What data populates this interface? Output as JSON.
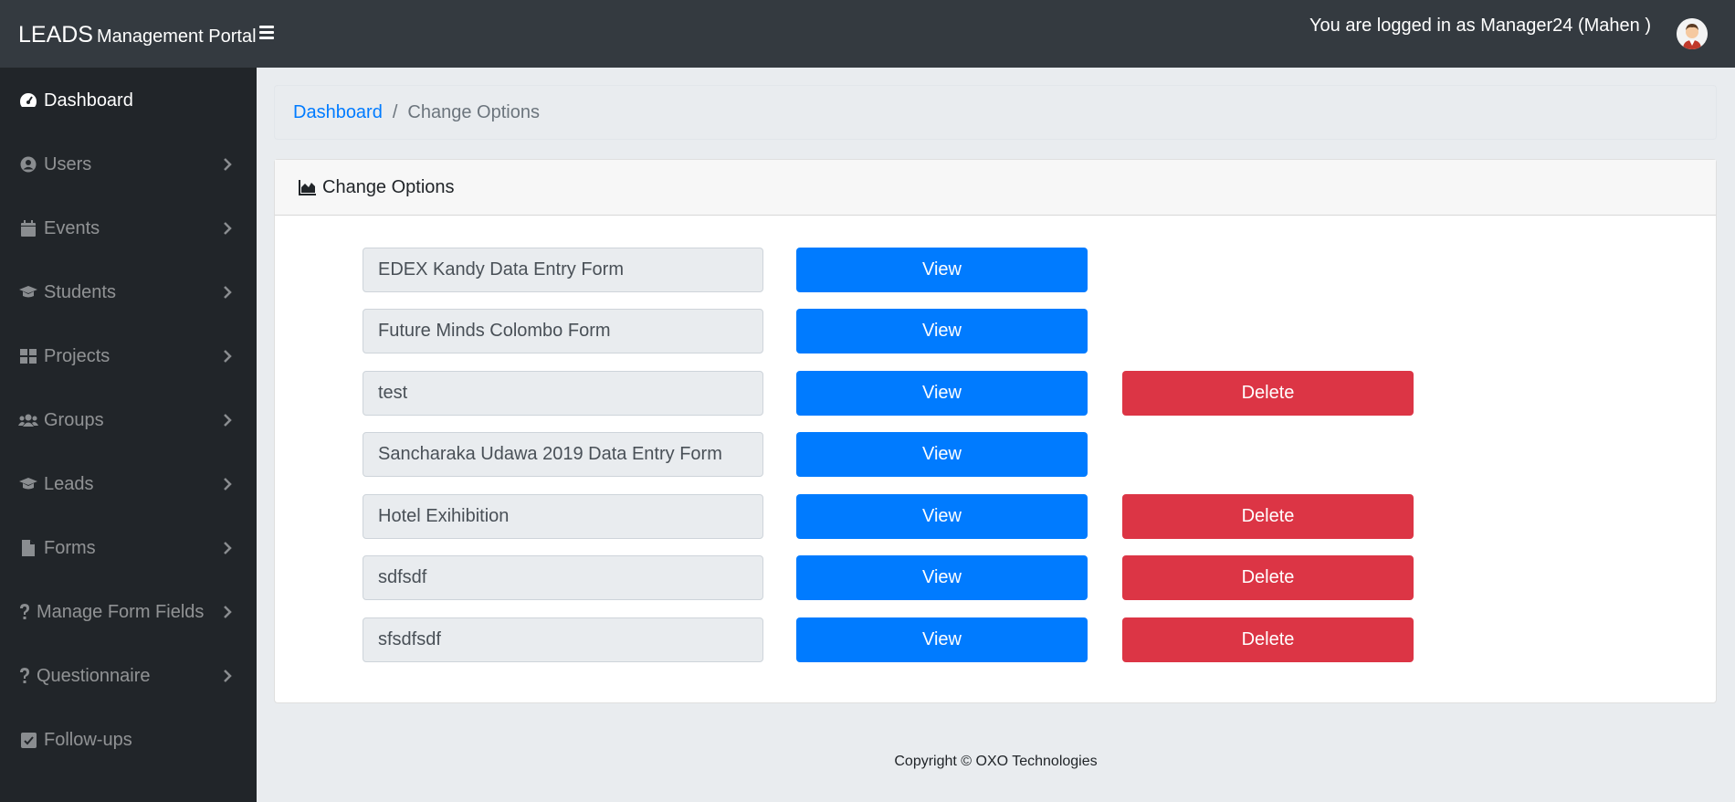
{
  "header": {
    "brand": "LEADS",
    "brand_sub": "Management Portal",
    "logged_in_text": "You are logged in as Manager24 (Mahen )"
  },
  "sidebar": {
    "items": [
      {
        "label": "Dashboard",
        "icon": "tachometer-icon"
      },
      {
        "label": "Users",
        "icon": "user-circle-icon"
      },
      {
        "label": "Events",
        "icon": "calendar-icon"
      },
      {
        "label": "Students",
        "icon": "graduation-cap-icon"
      },
      {
        "label": "Projects",
        "icon": "grid-icon"
      },
      {
        "label": "Groups",
        "icon": "users-icon"
      },
      {
        "label": "Leads",
        "icon": "graduation-cap-icon"
      },
      {
        "label": "Forms",
        "icon": "file-icon"
      },
      {
        "label": "Manage Form Fields",
        "icon": "question-icon"
      },
      {
        "label": "Questionnaire",
        "icon": "question-icon"
      },
      {
        "label": "Follow-ups",
        "icon": "check-square-icon"
      }
    ]
  },
  "breadcrumb": {
    "home": "Dashboard",
    "current": "Change Options"
  },
  "card": {
    "title": "Change Options",
    "view_label": "View",
    "delete_label": "Delete",
    "rows": [
      {
        "name": "EDEX Kandy Data Entry Form",
        "deletable": false
      },
      {
        "name": "Future Minds Colombo Form",
        "deletable": false
      },
      {
        "name": "test",
        "deletable": true
      },
      {
        "name": "Sancharaka Udawa 2019 Data Entry Form",
        "deletable": false
      },
      {
        "name": "Hotel Exihibition",
        "deletable": true
      },
      {
        "name": "sdfsdf",
        "deletable": true
      },
      {
        "name": "sfsdfsdf",
        "deletable": true
      }
    ]
  },
  "footer": {
    "copyright": "Copyright © OXO Technologies"
  },
  "colors": {
    "primary": "#007bff",
    "danger": "#dc3545",
    "topbar": "#343a40",
    "sidebar": "#212529"
  }
}
